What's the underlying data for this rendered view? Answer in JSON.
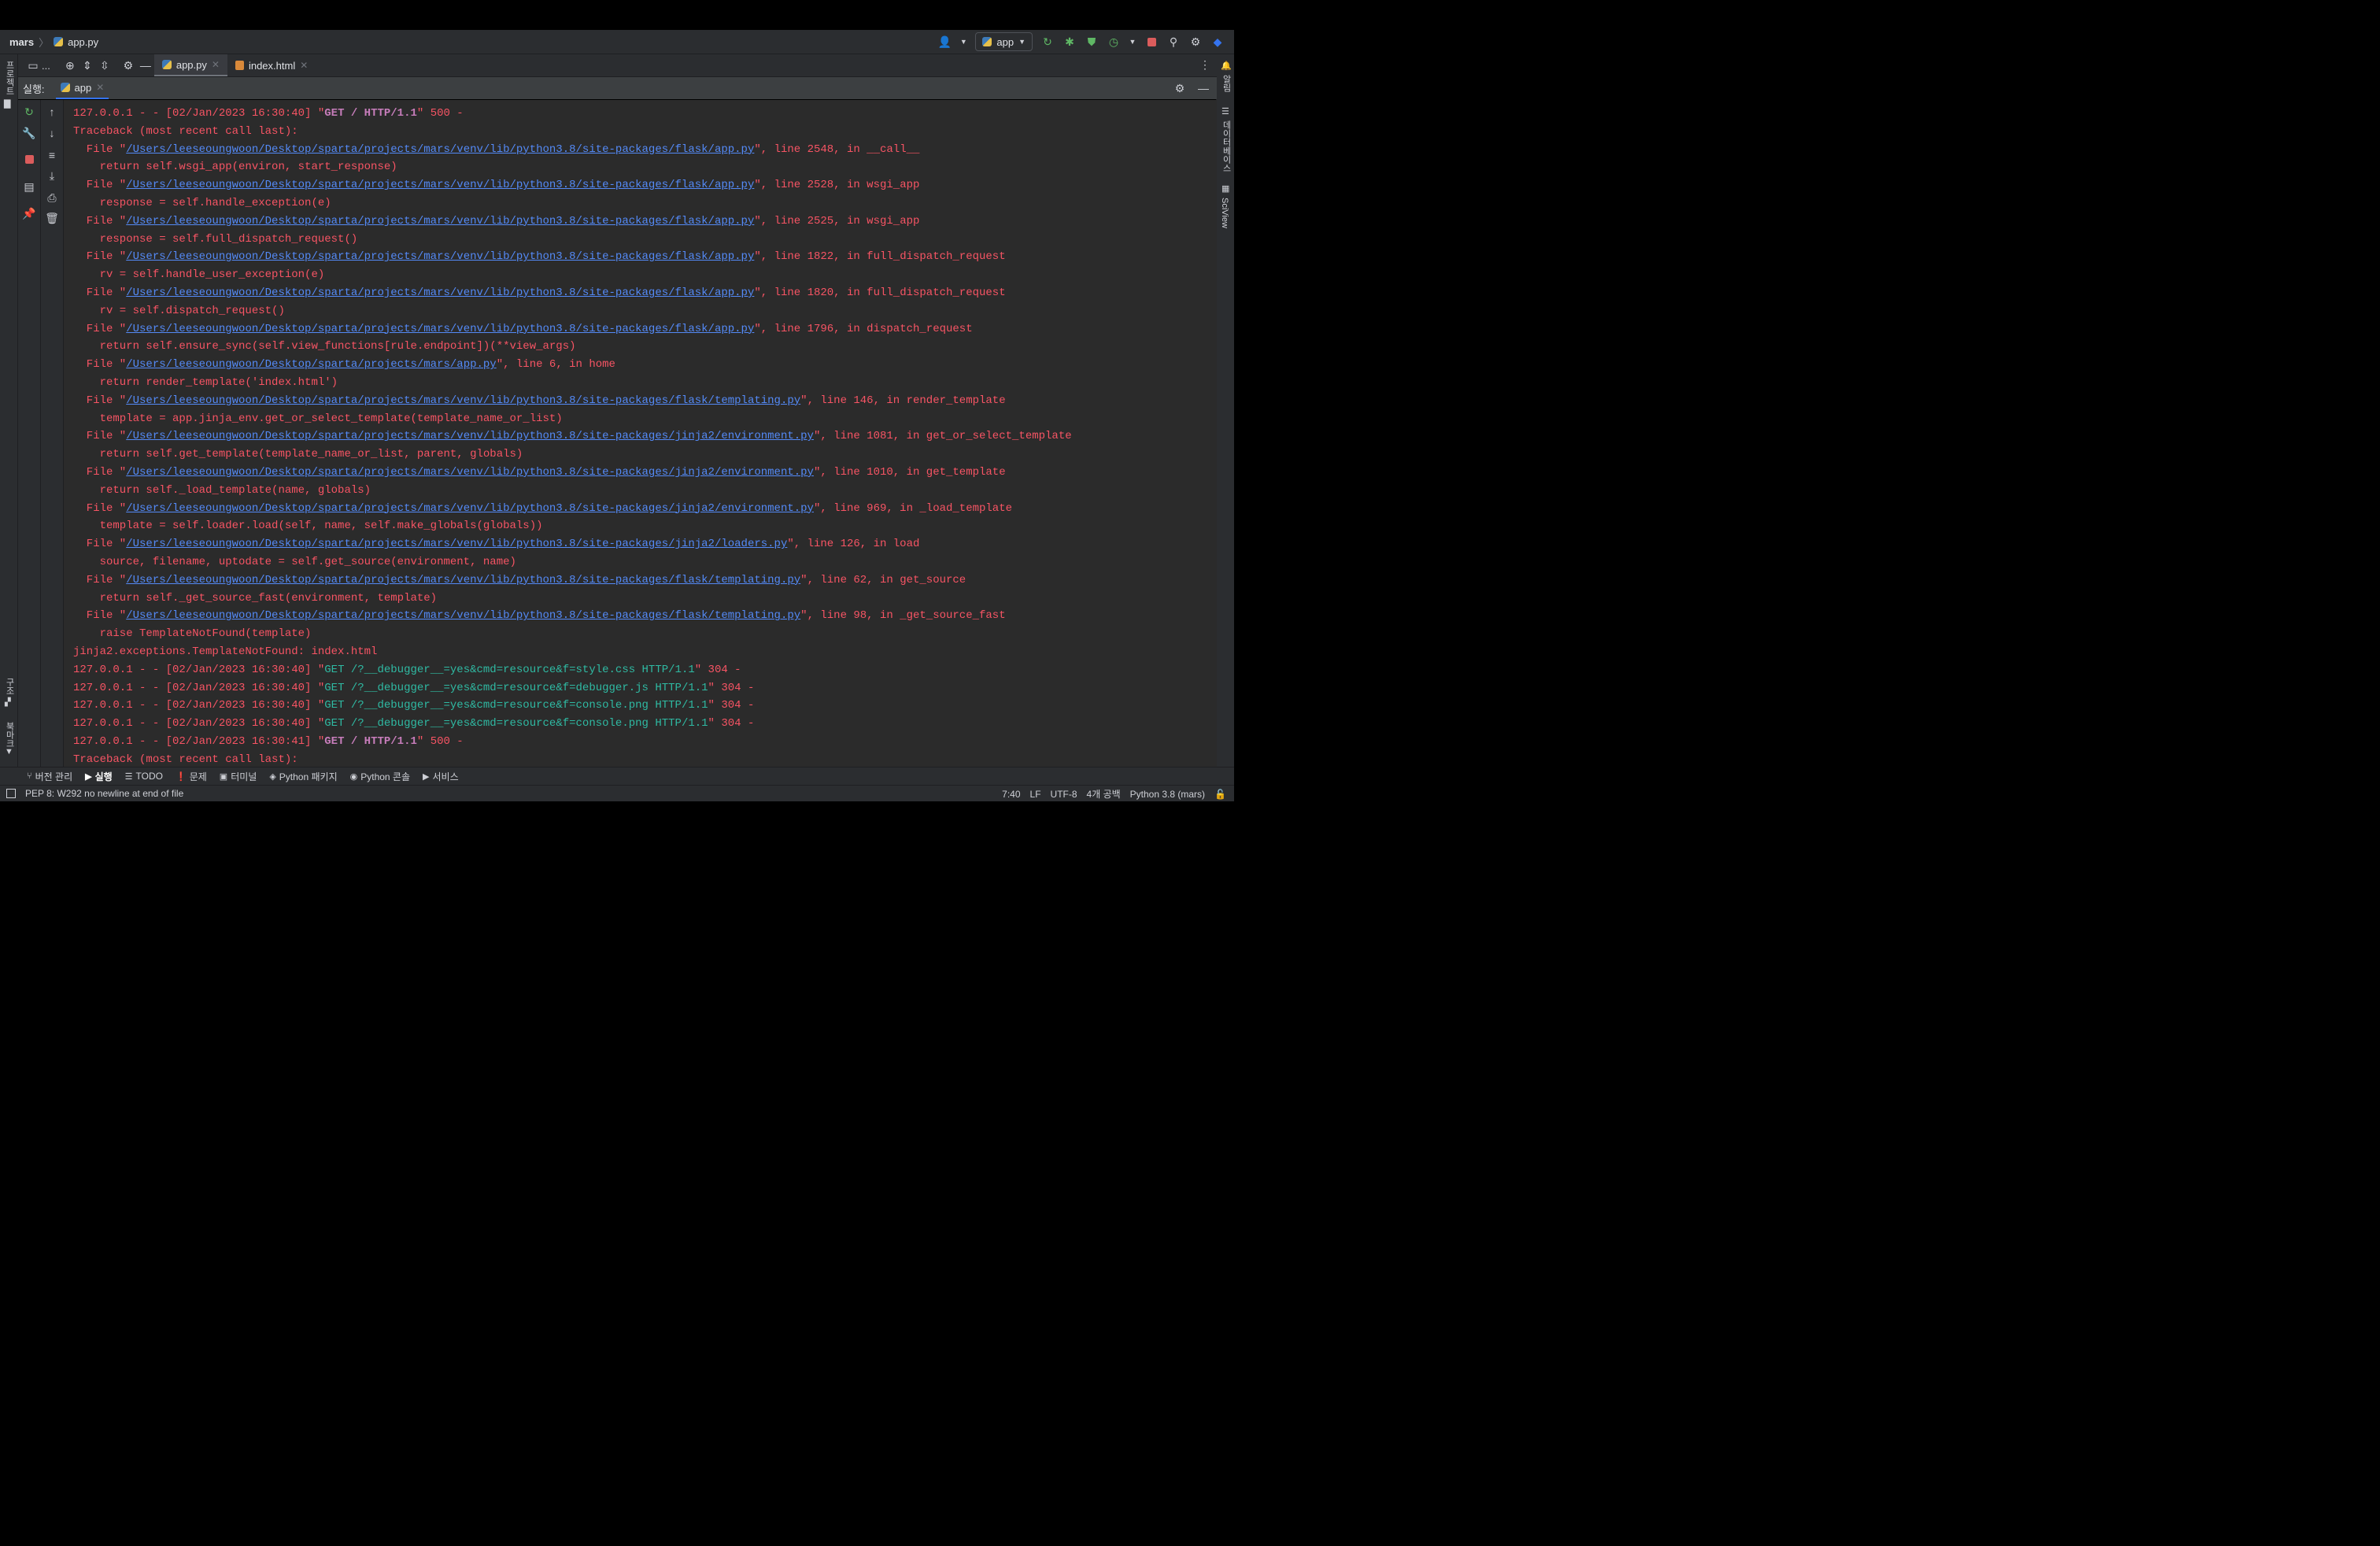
{
  "breadcrumb": {
    "project": "mars",
    "file": "app.py"
  },
  "run_config": {
    "name": "app"
  },
  "editor_tabs": [
    {
      "label": "app.py"
    },
    {
      "label": "index.html"
    }
  ],
  "tabbar_more": "...",
  "run_panel": {
    "label": "실행:",
    "tab": "app"
  },
  "left_stripe": {
    "project": "프로젝트",
    "structure": "구조",
    "bookmarks": "북마크"
  },
  "right_stripe": {
    "notifications": "알림",
    "database": "데이터베이스",
    "sciview": "SciView"
  },
  "console_lines": [
    {
      "type": "log",
      "pre": "127.0.0.1 - - [02/Jan/2023 16:30:40] \"",
      "req": "GET / HTTP/1.1",
      "post": "\" 500 -"
    },
    {
      "type": "text",
      "text": "Traceback (most recent call last):"
    },
    {
      "type": "file",
      "pre": "  File \"",
      "link": "/Users/leeseoungwoon/Desktop/sparta/projects/mars/venv/lib/python3.8/site-packages/flask/app.py",
      "post": "\", line 2548, in __call__"
    },
    {
      "type": "text",
      "text": "    return self.wsgi_app(environ, start_response)"
    },
    {
      "type": "file",
      "pre": "  File \"",
      "link": "/Users/leeseoungwoon/Desktop/sparta/projects/mars/venv/lib/python3.8/site-packages/flask/app.py",
      "post": "\", line 2528, in wsgi_app"
    },
    {
      "type": "text",
      "text": "    response = self.handle_exception(e)"
    },
    {
      "type": "file",
      "pre": "  File \"",
      "link": "/Users/leeseoungwoon/Desktop/sparta/projects/mars/venv/lib/python3.8/site-packages/flask/app.py",
      "post": "\", line 2525, in wsgi_app"
    },
    {
      "type": "text",
      "text": "    response = self.full_dispatch_request()"
    },
    {
      "type": "file",
      "pre": "  File \"",
      "link": "/Users/leeseoungwoon/Desktop/sparta/projects/mars/venv/lib/python3.8/site-packages/flask/app.py",
      "post": "\", line 1822, in full_dispatch_request"
    },
    {
      "type": "text",
      "text": "    rv = self.handle_user_exception(e)"
    },
    {
      "type": "file",
      "pre": "  File \"",
      "link": "/Users/leeseoungwoon/Desktop/sparta/projects/mars/venv/lib/python3.8/site-packages/flask/app.py",
      "post": "\", line 1820, in full_dispatch_request"
    },
    {
      "type": "text",
      "text": "    rv = self.dispatch_request()"
    },
    {
      "type": "file",
      "pre": "  File \"",
      "link": "/Users/leeseoungwoon/Desktop/sparta/projects/mars/venv/lib/python3.8/site-packages/flask/app.py",
      "post": "\", line 1796, in dispatch_request"
    },
    {
      "type": "text",
      "text": "    return self.ensure_sync(self.view_functions[rule.endpoint])(**view_args)"
    },
    {
      "type": "file",
      "pre": "  File \"",
      "link": "/Users/leeseoungwoon/Desktop/sparta/projects/mars/app.py",
      "post": "\", line 6, in home"
    },
    {
      "type": "text",
      "text": "    return render_template('index.html')"
    },
    {
      "type": "file",
      "pre": "  File \"",
      "link": "/Users/leeseoungwoon/Desktop/sparta/projects/mars/venv/lib/python3.8/site-packages/flask/templating.py",
      "post": "\", line 146, in render_template"
    },
    {
      "type": "text",
      "text": "    template = app.jinja_env.get_or_select_template(template_name_or_list)"
    },
    {
      "type": "file",
      "pre": "  File \"",
      "link": "/Users/leeseoungwoon/Desktop/sparta/projects/mars/venv/lib/python3.8/site-packages/jinja2/environment.py",
      "post": "\", line 1081, in get_or_select_template"
    },
    {
      "type": "text",
      "text": "    return self.get_template(template_name_or_list, parent, globals)"
    },
    {
      "type": "file",
      "pre": "  File \"",
      "link": "/Users/leeseoungwoon/Desktop/sparta/projects/mars/venv/lib/python3.8/site-packages/jinja2/environment.py",
      "post": "\", line 1010, in get_template"
    },
    {
      "type": "text",
      "text": "    return self._load_template(name, globals)"
    },
    {
      "type": "file",
      "pre": "  File \"",
      "link": "/Users/leeseoungwoon/Desktop/sparta/projects/mars/venv/lib/python3.8/site-packages/jinja2/environment.py",
      "post": "\", line 969, in _load_template"
    },
    {
      "type": "text",
      "text": "    template = self.loader.load(self, name, self.make_globals(globals))"
    },
    {
      "type": "file",
      "pre": "  File \"",
      "link": "/Users/leeseoungwoon/Desktop/sparta/projects/mars/venv/lib/python3.8/site-packages/jinja2/loaders.py",
      "post": "\", line 126, in load"
    },
    {
      "type": "text",
      "text": "    source, filename, uptodate = self.get_source(environment, name)"
    },
    {
      "type": "file",
      "pre": "  File \"",
      "link": "/Users/leeseoungwoon/Desktop/sparta/projects/mars/venv/lib/python3.8/site-packages/flask/templating.py",
      "post": "\", line 62, in get_source"
    },
    {
      "type": "text",
      "text": "    return self._get_source_fast(environment, template)"
    },
    {
      "type": "file",
      "pre": "  File \"",
      "link": "/Users/leeseoungwoon/Desktop/sparta/projects/mars/venv/lib/python3.8/site-packages/flask/templating.py",
      "post": "\", line 98, in _get_source_fast"
    },
    {
      "type": "text",
      "text": "    raise TemplateNotFound(template)"
    },
    {
      "type": "text",
      "text": "jinja2.exceptions.TemplateNotFound: index.html"
    },
    {
      "type": "log304",
      "pre": "127.0.0.1 - - [02/Jan/2023 16:30:40] \"",
      "req": "GET /?__debugger__=yes&cmd=resource&f=style.css HTTP/1.1",
      "post": "\" 304 -"
    },
    {
      "type": "log304",
      "pre": "127.0.0.1 - - [02/Jan/2023 16:30:40] \"",
      "req": "GET /?__debugger__=yes&cmd=resource&f=debugger.js HTTP/1.1",
      "post": "\" 304 -"
    },
    {
      "type": "log304",
      "pre": "127.0.0.1 - - [02/Jan/2023 16:30:40] \"",
      "req": "GET /?__debugger__=yes&cmd=resource&f=console.png HTTP/1.1",
      "post": "\" 304 -"
    },
    {
      "type": "log304",
      "pre": "127.0.0.1 - - [02/Jan/2023 16:30:40] \"",
      "req": "GET /?__debugger__=yes&cmd=resource&f=console.png HTTP/1.1",
      "post": "\" 304 -"
    },
    {
      "type": "log",
      "pre": "127.0.0.1 - - [02/Jan/2023 16:30:41] \"",
      "req": "GET / HTTP/1.1",
      "post": "\" 500 -"
    },
    {
      "type": "text",
      "text": "Traceback (most recent call last):"
    }
  ],
  "bottom_tools": [
    {
      "label": "버전 관리",
      "icon": "branch-icon",
      "glyph": "⑂"
    },
    {
      "label": "실행",
      "icon": "run-icon",
      "glyph": "▶",
      "active": true
    },
    {
      "label": "TODO",
      "icon": "list-icon",
      "glyph": "☰"
    },
    {
      "label": "문제",
      "icon": "problems-icon",
      "glyph": "❗"
    },
    {
      "label": "터미널",
      "icon": "terminal-icon",
      "glyph": "▣"
    },
    {
      "label": "Python 패키지",
      "icon": "layers-icon",
      "glyph": "◈"
    },
    {
      "label": "Python 콘솔",
      "icon": "python-icon",
      "glyph": "◉"
    },
    {
      "label": "서비스",
      "icon": "services-icon",
      "glyph": "▶"
    }
  ],
  "status": {
    "message": "PEP 8: W292 no newline at end of file",
    "position": "7:40",
    "line_ending": "LF",
    "encoding": "UTF-8",
    "indent": "4개 공백",
    "interpreter": "Python 3.8 (mars)"
  },
  "colors": {
    "console_bg": "#2b2b2b",
    "error_text": "#f75464",
    "link": "#548af7",
    "request_500": "#c77dbb",
    "request_304": "#2fbaa3"
  }
}
